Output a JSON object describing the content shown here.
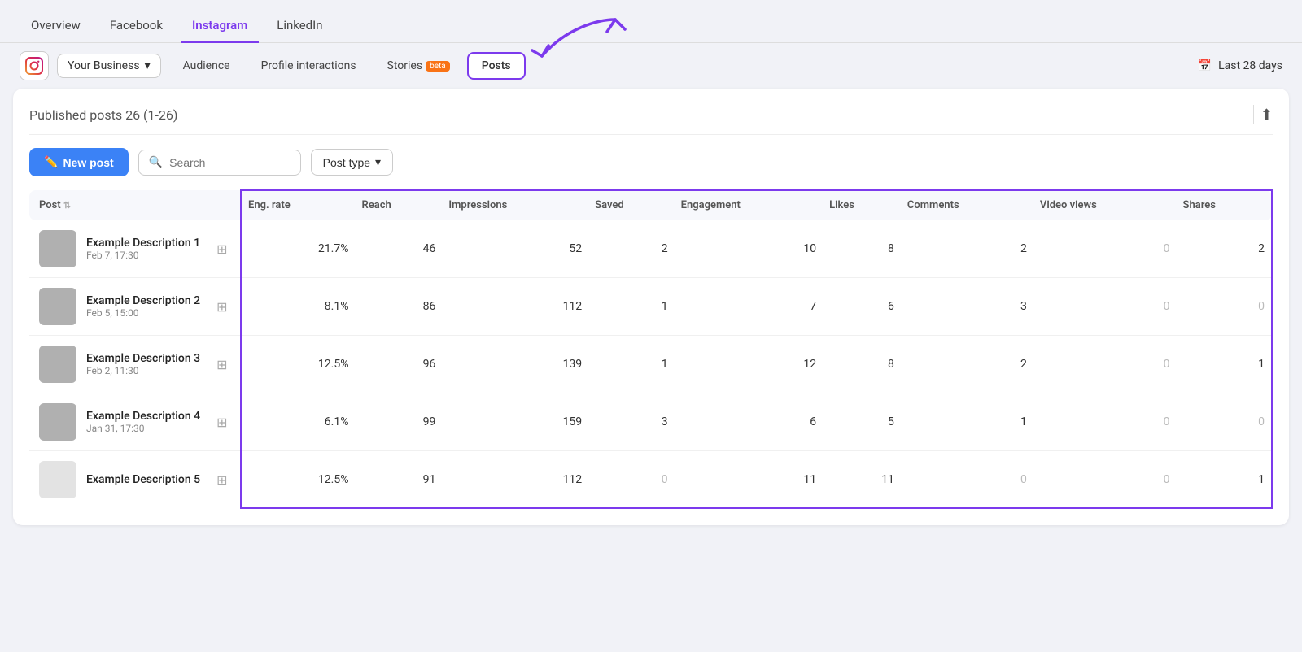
{
  "topNav": {
    "items": [
      {
        "label": "Overview",
        "active": false
      },
      {
        "label": "Facebook",
        "active": false
      },
      {
        "label": "Instagram",
        "active": true
      },
      {
        "label": "LinkedIn",
        "active": false
      }
    ]
  },
  "subNav": {
    "business": "Your Business",
    "tabs": [
      {
        "label": "Audience",
        "active": false
      },
      {
        "label": "Profile interactions",
        "active": false
      },
      {
        "label": "Stories",
        "active": false,
        "badge": "beta"
      },
      {
        "label": "Posts",
        "active": true
      }
    ],
    "dateRange": "Last 28 days"
  },
  "section": {
    "title": "Published posts",
    "count": "26 (1-26)"
  },
  "toolbar": {
    "newPost": "New post",
    "searchPlaceholder": "Search",
    "postType": "Post type"
  },
  "table": {
    "columns": [
      {
        "key": "post",
        "label": "Post",
        "highlight": false
      },
      {
        "key": "eng_rate",
        "label": "Eng. rate",
        "highlight": true
      },
      {
        "key": "reach",
        "label": "Reach",
        "highlight": true
      },
      {
        "key": "impressions",
        "label": "Impressions",
        "highlight": true
      },
      {
        "key": "saved",
        "label": "Saved",
        "highlight": true
      },
      {
        "key": "engagement",
        "label": "Engagement",
        "highlight": true
      },
      {
        "key": "likes",
        "label": "Likes",
        "highlight": true
      },
      {
        "key": "comments",
        "label": "Comments",
        "highlight": true
      },
      {
        "key": "video_views",
        "label": "Video views",
        "highlight": true
      },
      {
        "key": "shares",
        "label": "Shares",
        "highlight": true
      }
    ],
    "rows": [
      {
        "desc": "Example Description 1",
        "date": "Feb 7, 17:30",
        "eng_rate": "21.7%",
        "reach": "46",
        "impressions": "52",
        "saved": "2",
        "engagement": "10",
        "likes": "8",
        "comments": "2",
        "video_views": "0",
        "shares": "2",
        "faded": false
      },
      {
        "desc": "Example Description 2",
        "date": "Feb 5, 15:00",
        "eng_rate": "8.1%",
        "reach": "86",
        "impressions": "112",
        "saved": "1",
        "engagement": "7",
        "likes": "6",
        "comments": "3",
        "video_views": "0",
        "shares": "0",
        "faded": false
      },
      {
        "desc": "Example Description 3",
        "date": "Feb 2, 11:30",
        "eng_rate": "12.5%",
        "reach": "96",
        "impressions": "139",
        "saved": "1",
        "engagement": "12",
        "likes": "8",
        "comments": "2",
        "video_views": "0",
        "shares": "1",
        "faded": false
      },
      {
        "desc": "Example Description 4",
        "date": "Jan 31, 17:30",
        "eng_rate": "6.1%",
        "reach": "99",
        "impressions": "159",
        "saved": "3",
        "engagement": "6",
        "likes": "5",
        "comments": "1",
        "video_views": "0",
        "shares": "0",
        "faded": false
      },
      {
        "desc": "Example Description 5",
        "date": "",
        "eng_rate": "12.5%",
        "reach": "91",
        "impressions": "112",
        "saved": "0",
        "engagement": "11",
        "likes": "11",
        "comments": "0",
        "video_views": "0",
        "shares": "1",
        "faded": true
      }
    ]
  }
}
